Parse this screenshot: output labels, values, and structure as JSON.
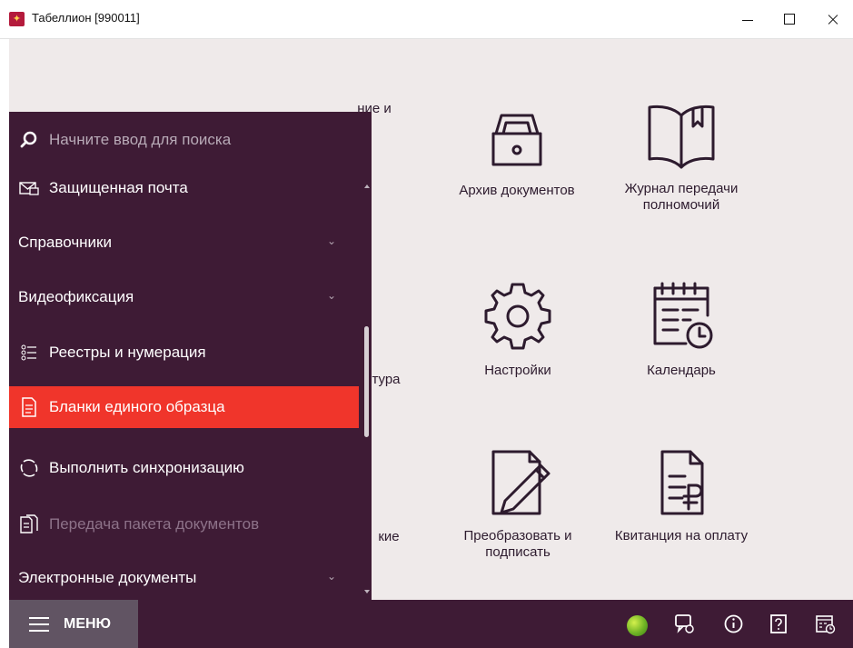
{
  "window": {
    "title": "Табеллион [990011]",
    "controls": [
      "minimize",
      "maximize",
      "close"
    ]
  },
  "tiles": [
    {
      "label": "ние и",
      "icon": "partial-icon"
    },
    {
      "label": "Архив документов",
      "icon": "archive-box-icon"
    },
    {
      "label": "Журнал передачи полномочий",
      "icon": "book-icon"
    },
    {
      "label": "тура",
      "icon": "partial-icon"
    },
    {
      "label": "Настройки",
      "icon": "gear-icon"
    },
    {
      "label": "Календарь",
      "icon": "calendar-icon"
    },
    {
      "label": "кие",
      "icon": "partial-icon"
    },
    {
      "label": "Преобразовать и подписать",
      "icon": "sign-document-icon"
    },
    {
      "label": "Квитанция на оплату",
      "icon": "receipt-ruble-icon"
    }
  ],
  "menu": {
    "search_placeholder": "Начните ввод для поиска",
    "items": [
      {
        "label": "Защищенная почта",
        "icon": "secure-mail-icon",
        "state": "normal"
      },
      {
        "label": "Справочники",
        "icon": "",
        "state": "normal",
        "expandable": true
      },
      {
        "label": "Видеофиксация",
        "icon": "",
        "state": "normal",
        "expandable": true
      },
      {
        "label": "Реестры и нумерация",
        "icon": "registry-icon",
        "state": "normal"
      },
      {
        "label": "Бланки единого образца",
        "icon": "form-document-icon",
        "state": "active"
      },
      {
        "label": "Выполнить синхронизацию",
        "icon": "sync-icon",
        "state": "normal"
      },
      {
        "label": "Передача пакета документов",
        "icon": "document-package-icon",
        "state": "disabled"
      },
      {
        "label": "Электронные документы",
        "icon": "",
        "state": "normal",
        "expandable": true
      }
    ]
  },
  "bottom_bar": {
    "menu_button_label": "МЕНЮ",
    "status": "online",
    "icons": [
      "chat-icon",
      "info-icon",
      "help-icon",
      "calendar-clock-icon"
    ]
  },
  "colors": {
    "menu_background": "#3e1b35",
    "active_item": "#f0352b",
    "workspace": "#efeaea",
    "ink": "#2d1b2e"
  }
}
